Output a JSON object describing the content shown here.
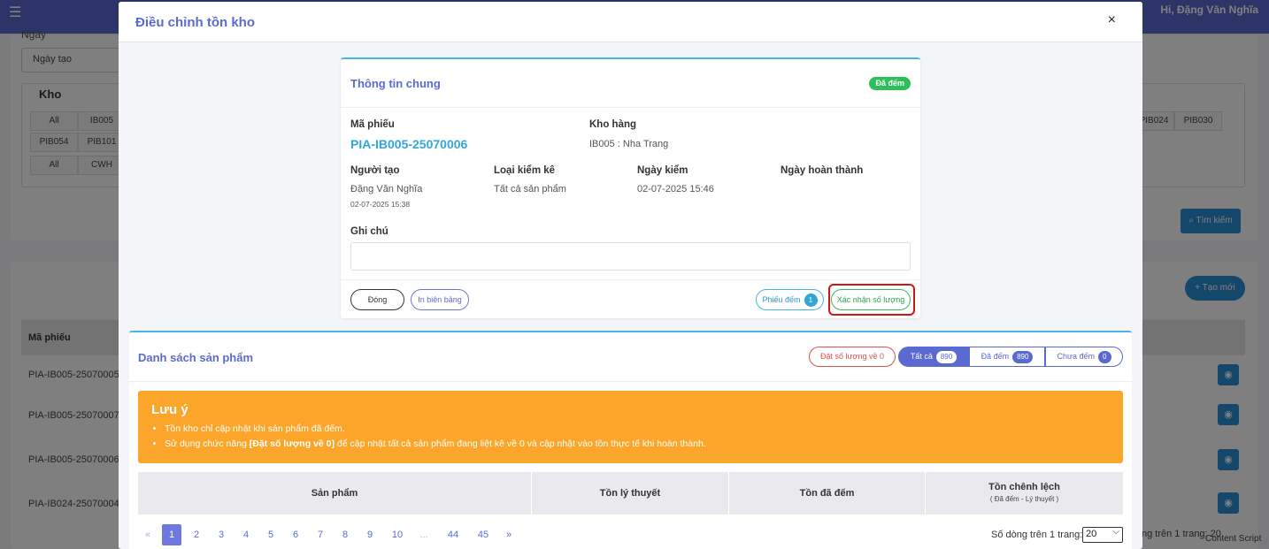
{
  "background": {
    "user_greeting": "Hi, Đặng Văn Nghĩa",
    "date_label": "Ngày",
    "date_select": "Ngày tạo",
    "warehouse_title": "Kho",
    "warehouse_chips_row1": [
      "All",
      "IB005"
    ],
    "warehouse_chips_row2": [
      "PIB054",
      "PIB101"
    ],
    "warehouse_chips_row3": [
      "All",
      "CWH"
    ],
    "warehouse_chips_right": [
      "PIB024",
      "PIB030"
    ],
    "search_button": "Tìm kiếm",
    "create_button": "Tạo mới",
    "table_header": "Mã phiếu",
    "rows": [
      "PIA-IB005-25070005",
      "PIA-IB005-25070007",
      "PIA-IB005-25070006",
      "PIA-IB024-25070004"
    ],
    "pager_text": "ng trên 1 trang:",
    "pager_value": "20",
    "extension_text": "Content Script"
  },
  "modal": {
    "title": "Điều chỉnh tồn kho",
    "close_icon": "×",
    "info": {
      "title": "Thông tin chung",
      "status": "Đã đếm",
      "code_label": "Mã phiếu",
      "code_value": "PIA-IB005-25070006",
      "warehouse_label": "Kho hàng",
      "warehouse_value": "IB005 : Nha Trang",
      "creator_label": "Người tạo",
      "creator_value": "Đặng Văn Nghĩa",
      "creator_date": "02-07-2025 15:38",
      "check_type_label": "Loại kiểm kê",
      "check_type_value": "Tất cả sản phẩm",
      "check_date_label": "Ngày kiểm",
      "check_date_value": "02-07-2025 15:46",
      "complete_date_label": "Ngày hoàn thành",
      "note_label": "Ghi chú",
      "close_button": "Đóng",
      "print_button": "In biên bảng",
      "count_button": "Phiếu đếm",
      "count_badge": "1",
      "confirm_button": "Xác nhận số lượng"
    },
    "products": {
      "title": "Danh sách sản phẩm",
      "reset_button": "Đặt số lượng về 0",
      "filter_all": "Tất cả",
      "filter_all_count": "890",
      "filter_counted": "Đã đếm",
      "filter_counted_count": "890",
      "filter_uncounted": "Chưa đếm",
      "filter_uncounted_count": "0",
      "notice_title": "Lưu ý",
      "notice_line1": "Tồn kho chỉ cập nhật khi sản phẩm đã đếm.",
      "notice_line2_prefix": "Sử dụng chức năng ",
      "notice_line2_bold": "[Đặt số lượng về 0]",
      "notice_line2_suffix": " để cập nhật tất cả sản phẩm đang liệt kê về 0 và cập nhật vào tồn thực tế khi hoàn thành.",
      "columns": [
        "Sản phẩm",
        "Tồn lý thuyết",
        "Tồn đã đếm",
        "Tồn chênh lệch"
      ],
      "column_sub": "( Đã đếm - Lý thuyết )",
      "pages": [
        "«",
        "1",
        "2",
        "3",
        "4",
        "5",
        "6",
        "7",
        "8",
        "9",
        "10",
        "...",
        "44",
        "45",
        "»"
      ],
      "rows_per_page_label": "Số dòng trên 1 trang:",
      "rows_per_page_value": "20"
    }
  },
  "colors": {
    "primary": "#5b6ad0",
    "info": "#33a6d6",
    "success": "#2fbf5a",
    "danger": "#d9534f",
    "warning": "#fba52a",
    "highlight": "#d01515"
  }
}
